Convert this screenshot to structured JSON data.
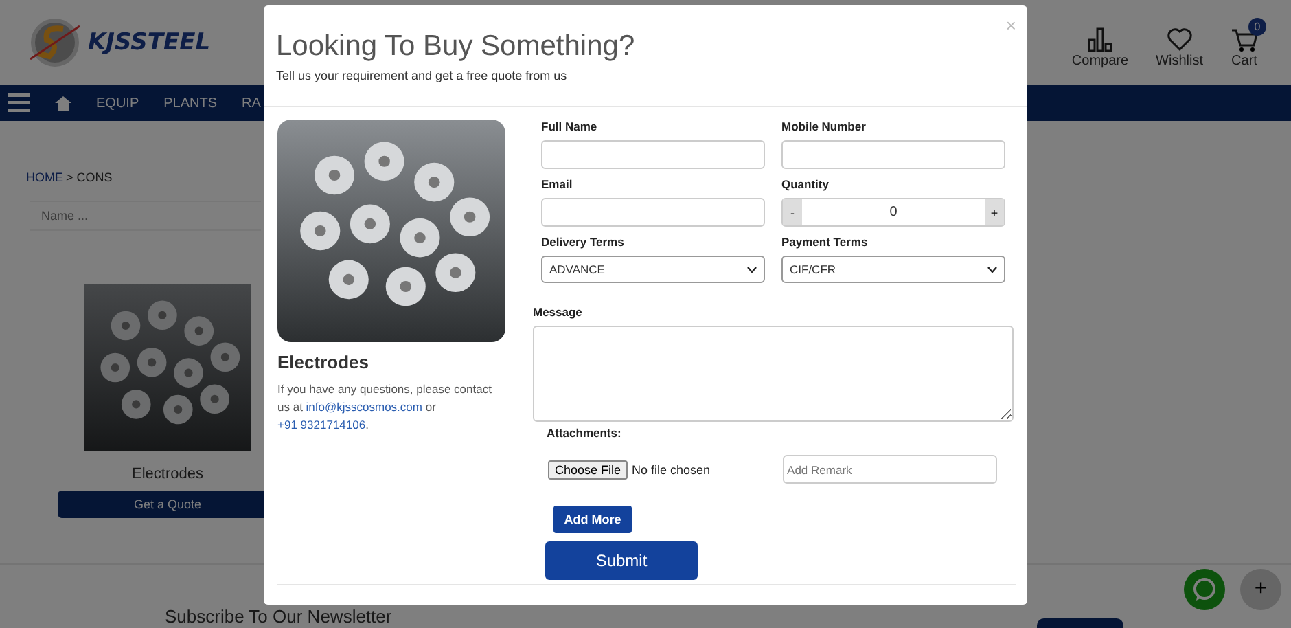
{
  "header": {
    "logo_text": "KJSSTEEL",
    "actions": [
      {
        "kind": "compare",
        "label": "Compare"
      },
      {
        "kind": "wishlist",
        "label": "Wishlist"
      },
      {
        "kind": "cart",
        "label": "Cart",
        "badge": "0"
      }
    ]
  },
  "nav": {
    "items": [
      "EQUIP",
      "PLANTS",
      "RA"
    ]
  },
  "breadcrumb": {
    "home": "HOME",
    "current": "> CONS"
  },
  "search": {
    "placeholder": "Name ..."
  },
  "product": {
    "name": "Electrodes",
    "button": "Get a Quote"
  },
  "newsletter": {
    "title": "Subscribe To Our Newsletter"
  },
  "modal": {
    "title": "Looking To Buy Something?",
    "subtitle": "Tell us your requirement and get a free quote from us",
    "close": "×",
    "product_name": "Electrodes",
    "contact": {
      "before": "If you have any questions, please contact us at",
      "email": "info@kjsscosmos.com",
      "middle": "or",
      "phone": "+91 9321714106",
      "after": "."
    },
    "fields": [
      {
        "kind": "text",
        "label": "Full Name"
      },
      {
        "kind": "text",
        "label": "Mobile Number"
      },
      {
        "kind": "text",
        "label": "Email"
      },
      {
        "kind": "stepper",
        "label": "Quantity",
        "value": "0",
        "minus": "-",
        "plus": "+"
      },
      {
        "kind": "select",
        "label": "Delivery Terms",
        "value": "ADVANCE"
      },
      {
        "kind": "select",
        "label": "Payment Terms",
        "value": "CIF/CFR"
      }
    ],
    "message": {
      "label": "Message"
    },
    "attachments": {
      "label": "Attachments:",
      "file_button": "Choose File",
      "file_status": "No file chosen",
      "remark_placeholder": "Add Remark",
      "add_more": "Add More"
    },
    "submit": "Submit"
  },
  "floating": {
    "plus": "+"
  }
}
